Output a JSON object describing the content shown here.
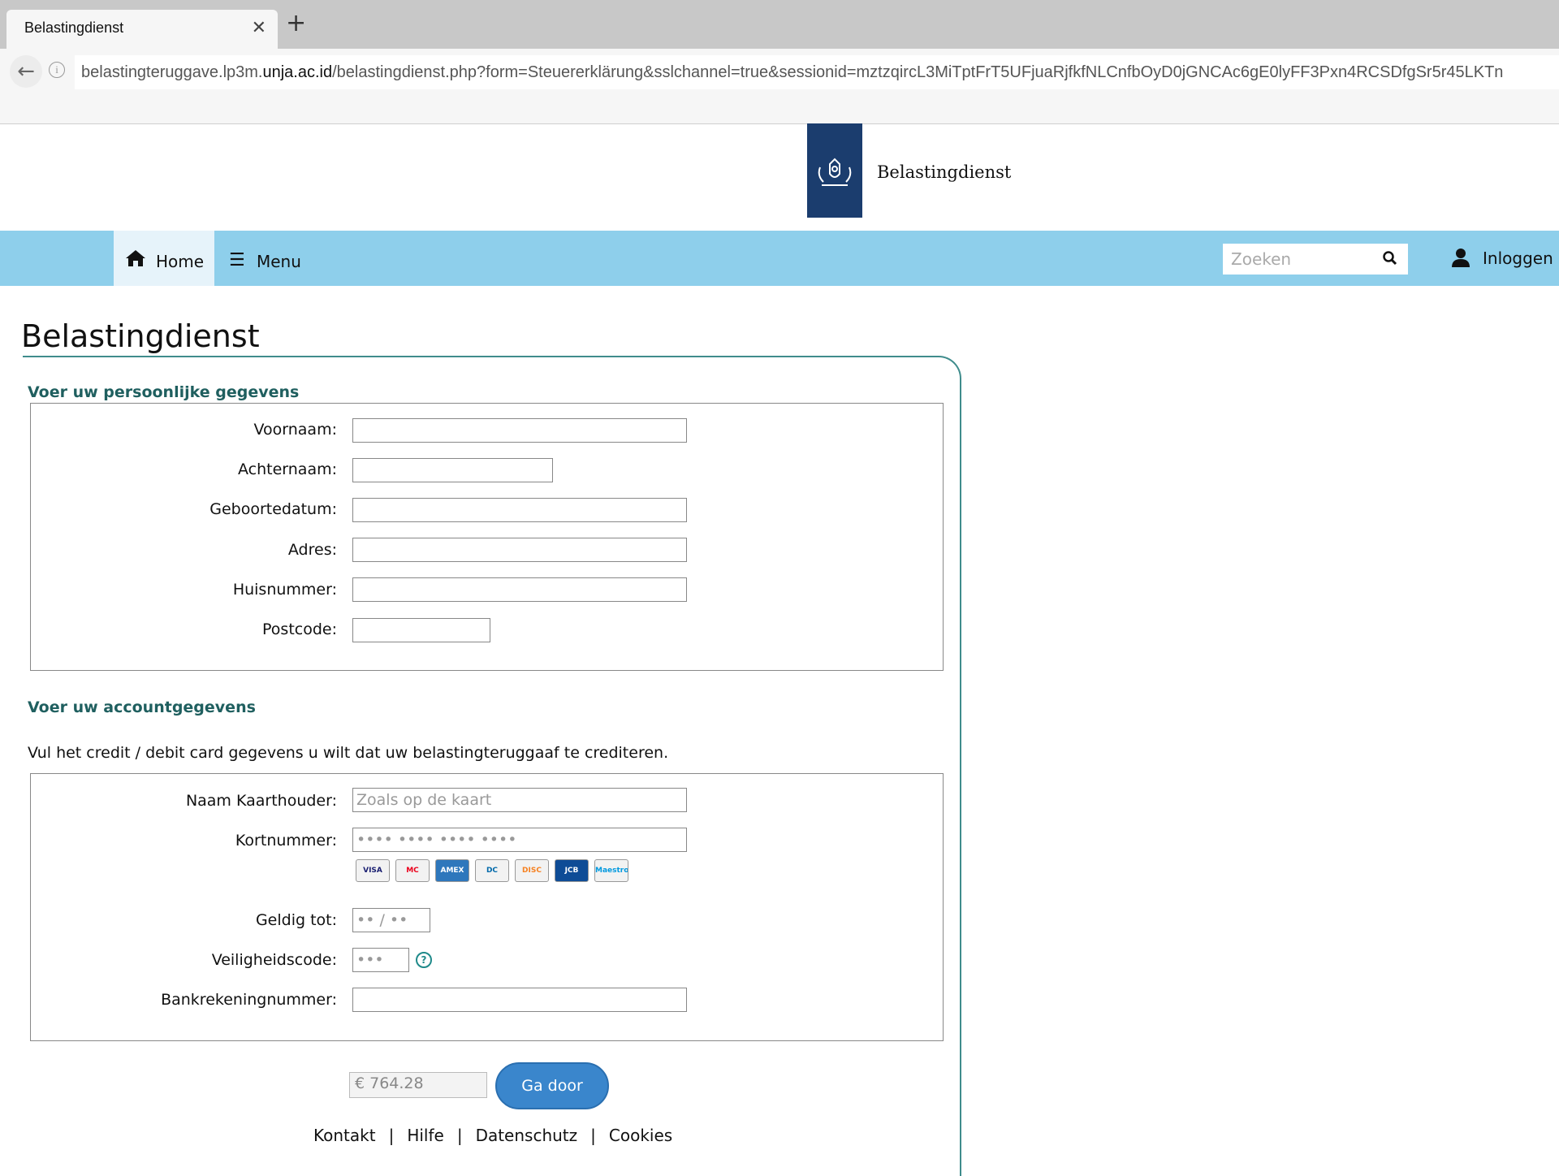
{
  "browser": {
    "tab_title": "Belastingdienst",
    "url_prefix": "belastingteruggave.lp3m.",
    "url_domain": "unja.ac.id",
    "url_path": "/belastingdienst.php?form=Steuererklärung&sslchannel=true&sessionid=mztzqircL3MiTptFrT5UFjuaRjfkfNLCnfbOyD0jGNCAc6gE0lyFF3Pxn4RCSDfgSr5r45LKTn"
  },
  "header": {
    "logo_text": "Belastingdienst"
  },
  "nav": {
    "home_label": "Home",
    "menu_label": "Menu",
    "search_placeholder": "Zoeken",
    "login_label": "Inloggen"
  },
  "page": {
    "title": "Belastingdienst"
  },
  "personal": {
    "title": "Voer uw persoonlijke gegevens",
    "fields": [
      {
        "label": "Voornaam:"
      },
      {
        "label": "Achternaam:"
      },
      {
        "label": "Geboortedatum:"
      },
      {
        "label": "Adres:"
      },
      {
        "label": "Huisnummer:"
      },
      {
        "label": "Postcode:"
      }
    ]
  },
  "account": {
    "title": "Voer uw accountgegevens",
    "instruction": "Vul het credit / debit card gegevens u wilt dat uw belastingteruggaaf te crediteren.",
    "cardholder_label": "Naam Kaarthouder:",
    "cardholder_placeholder": "Zoals op de kaart",
    "cardnumber_label": "Kortnummer:",
    "cardnumber_placeholder": "•••• •••• •••• ••••",
    "expiry_label": "Geldig tot:",
    "expiry_placeholder": "•• / ••",
    "cvv_label": "Veiligheidscode:",
    "cvv_placeholder": "•••",
    "iban_label": "Bankrekeningnummer:",
    "card_logos": [
      "VISA",
      "MC",
      "AMEX",
      "DC",
      "DISC",
      "JCB",
      "Maestro"
    ]
  },
  "submit": {
    "amount": "€ 764.28",
    "button_label": "Ga door"
  },
  "footer": {
    "links": [
      "Kontakt",
      "Hilfe",
      "Datenschutz",
      "Cookies"
    ]
  },
  "colors": {
    "nav_bg": "#8ecfeb",
    "logo_bg": "#1b3d6e",
    "section_title": "#1f5f5f",
    "button": "#3a86cc"
  }
}
